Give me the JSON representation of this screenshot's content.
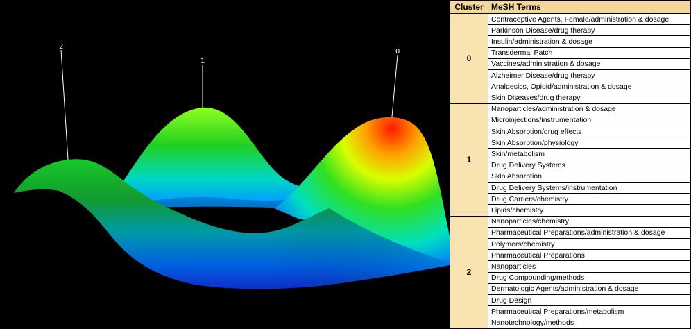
{
  "surface": {
    "peaks": [
      {
        "label": "2"
      },
      {
        "label": "1"
      },
      {
        "label": "0"
      }
    ]
  },
  "table": {
    "headers": {
      "cluster": "Cluster",
      "terms": "MeSH Terms"
    },
    "clusters": [
      {
        "id": "0",
        "terms": [
          "Contraceptive Agents, Female/administration & dosage",
          "Parkinson Disease/drug therapy",
          "Insulin/administration & dosage",
          "Transdermal Patch",
          "Vaccines/administration & dosage",
          "Alzheimer Disease/drug therapy",
          "Analgesics, Opioid/administration & dosage",
          "Skin Diseases/drug therapy"
        ]
      },
      {
        "id": "1",
        "terms": [
          "Nanoparticles/administration & dosage",
          "Microinjections/instrumentation",
          "Skin Absorption/drug effects",
          "Skin Absorption/physiology",
          "Skin/metabolism",
          "Drug Delivery Systems",
          "Skin Absorption",
          "Drug Delivery Systems/instrumentation",
          "Drug Carriers/chemistry",
          "Lipids/chemistry"
        ]
      },
      {
        "id": "2",
        "terms": [
          "Nanoparticles/chemistry",
          "Pharmaceutical Preparations/administration & dosage",
          "Polymers/chemistry",
          "Pharmaceutical Preparations",
          "Nanoparticles",
          "Drug Compounding/methods",
          "Dermatologic Agents/administration & dosage",
          "Drug Design",
          "Pharmaceutical Preparations/metabolism",
          "Nanotechnology/methods"
        ]
      }
    ]
  }
}
